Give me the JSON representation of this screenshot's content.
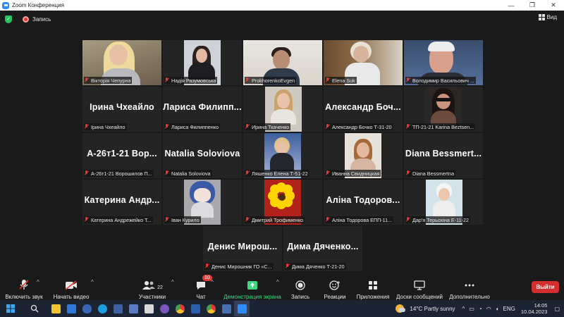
{
  "window": {
    "title": "Zoom Конференция",
    "controls": [
      "—",
      "❐",
      "✕"
    ]
  },
  "topbar": {
    "recording_label": "Запись",
    "view_label": "Вид"
  },
  "participants": [
    {
      "display_name": "Вікторія Чепурна",
      "big_name": "",
      "video": "blond",
      "active": true
    },
    {
      "display_name": "Надія Разумовська",
      "big_name": "",
      "video": "portrait"
    },
    {
      "display_name": "ProkhorenkoEvgen",
      "big_name": "",
      "video": "room"
    },
    {
      "display_name": "Elena Suk",
      "big_name": "",
      "video": "elena"
    },
    {
      "display_name": "Володимир Васильович ...",
      "big_name": "",
      "video": "man"
    },
    {
      "display_name": "Ірина Чхеайло",
      "big_name": "Ірина Чхеайло"
    },
    {
      "display_name": "Лариса Филиппенко",
      "big_name": "Лариса Филипп..."
    },
    {
      "display_name": "Ирина Ткаченко",
      "big_name": "",
      "video": "irina"
    },
    {
      "display_name": "Александр Бочко Т-31-20",
      "big_name": "Александр Боч..."
    },
    {
      "display_name": "ТП-21-21 Karina Beztsen...",
      "big_name": "",
      "video": "karina"
    },
    {
      "display_name": "А-26т1-21 Ворошилов П...",
      "big_name": "А-26т1-21 Вор..."
    },
    {
      "display_name": "Natalia Soloviova",
      "big_name": "Natalia Soloviova"
    },
    {
      "display_name": "Ляшенко Елена Т-51-22",
      "big_name": "",
      "video": "elena2"
    },
    {
      "display_name": "Иванна Свидницкая",
      "big_name": "",
      "video": "ivanna"
    },
    {
      "display_name": "Diana Bessmertna",
      "big_name": "Diana Bessmert..."
    },
    {
      "display_name": "Катерина Андрежейко Т...",
      "big_name": "Катерина Андр..."
    },
    {
      "display_name": "Іван Курило",
      "big_name": "",
      "video": "ivan"
    },
    {
      "display_name": "Дмитрий Трофименко",
      "big_name": "",
      "video": "flower"
    },
    {
      "display_name": "Аліна Тодорова ЕПП-11...",
      "big_name": "Аліна Тодоров..."
    },
    {
      "display_name": "Дар'я Терьохіна Е-11-22",
      "big_name": "",
      "video": "child"
    },
    {
      "display_name": "Денис Мирошник ГО «С...",
      "big_name": "Денис Мирош..."
    },
    {
      "display_name": "Дима Дяченко Т-21-20",
      "big_name": "Дима Дяченко..."
    }
  ],
  "toolbar": {
    "unmute": "Включить звук",
    "start_video": "Начать видео",
    "participants": "Участники",
    "participants_count": "22",
    "chat": "Чат",
    "chat_badge": "10",
    "share": "Демонстрация экрана",
    "record": "Запись",
    "reactions": "Реакции",
    "apps": "Приложения",
    "whiteboards": "Доски сообщений",
    "more": "Дополнительно",
    "leave": "Выйти"
  },
  "taskbar": {
    "weather": "14°C  Partly sunny",
    "lang": "ENG",
    "time": "14:05",
    "date": "10.04.2023"
  },
  "colors": {
    "active_speaker": "#f1e05a",
    "leave": "#d32f2f",
    "share_green": "#3fd97f",
    "muted_red": "#e53935"
  }
}
